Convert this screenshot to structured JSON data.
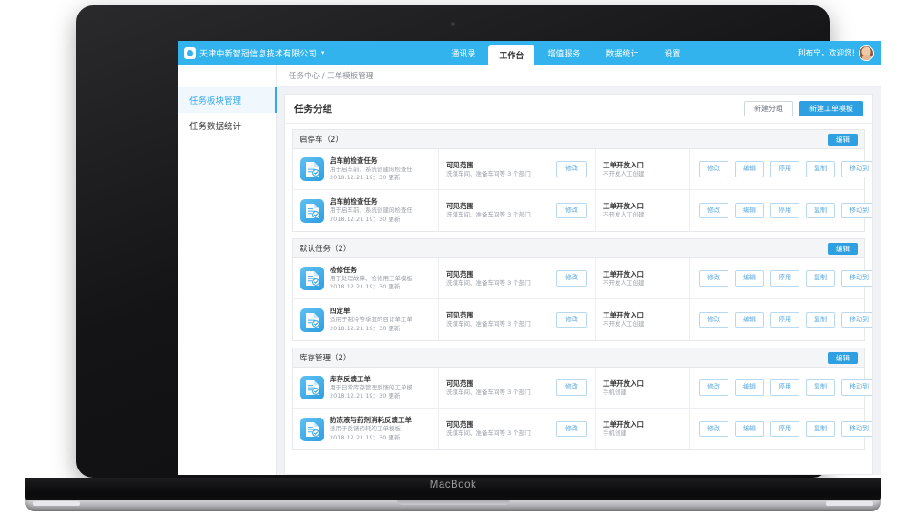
{
  "device": {
    "label": "MacBook"
  },
  "header": {
    "brand": "天津中新智冠信息技术有限公司",
    "brand_caret": "▾",
    "nav": [
      {
        "label": "通讯录",
        "active": false
      },
      {
        "label": "工作台",
        "active": true
      },
      {
        "label": "增值服务",
        "active": false
      },
      {
        "label": "数据统计",
        "active": false
      },
      {
        "label": "设置",
        "active": false
      }
    ],
    "welcome": "利布宁，欢迎您!"
  },
  "sidebar": {
    "items": [
      {
        "label": "任务板块管理",
        "active": true
      },
      {
        "label": "任务数据统计",
        "active": false
      }
    ]
  },
  "breadcrumb": "任务中心 / 工单模板管理",
  "panel": {
    "title": "任务分组",
    "new_group_label": "新建分组",
    "new_template_label": "新建工单模板",
    "group_edit_label": "编辑"
  },
  "labels": {
    "scope_label": "可见范围",
    "entry_label": "工单开放入口",
    "modify_label": "修改"
  },
  "ops": [
    "修改",
    "编辑",
    "停用",
    "复制",
    "移动到"
  ],
  "groups": [
    {
      "title": "启停车（2）",
      "rows": [
        {
          "name": "启车前检查任务",
          "desc": "用于启车前，系统创建的检查任",
          "time": "2018.12.21 19：30 更新",
          "scope": "洗煤车间、准备车间等 3 个部门",
          "entry": "不开发人工创建"
        },
        {
          "name": "启车前检查任务",
          "desc": "用于启车前，系统创建的检查任",
          "time": "2018.12.21 19：30 更新",
          "scope": "洗煤车间、准备车间等 3 个部门",
          "entry": "不开发人工创建"
        }
      ]
    },
    {
      "title": "默认任务（2）",
      "rows": [
        {
          "name": "检修任务",
          "desc": "用于处理故障、检修用工单模板",
          "time": "2018.12.21 19：30 更新",
          "scope": "洗煤车间、准备车间等 3 个部门",
          "entry": "不开发人工创建"
        },
        {
          "name": "四定单",
          "desc": "适用于制冷等季度的召订单工单",
          "time": "2018.12.21 19：30 更新",
          "scope": "洗煤车间、准备车间等 3 个部门",
          "entry": "不开发人工创建"
        }
      ]
    },
    {
      "title": "库存管理（2）",
      "rows": [
        {
          "name": "库存反馈工单",
          "desc": "用于日常库存管理反馈的工单模",
          "time": "2018.12.21 19：30 更新",
          "scope": "洗煤车间、准备车间等 3 个部门",
          "entry": "手机创建"
        },
        {
          "name": "防冻液与药剂消耗反馈工单",
          "desc": "适用于反馈药耗的工单模板",
          "time": "2018.12.21 19：30 更新",
          "scope": "洗煤车间、准备车间等 3 个部门",
          "entry": "手机创建"
        }
      ]
    }
  ],
  "colors": {
    "brand_blue": "#33b3ee",
    "primary": "#2e9fe0",
    "bg": "#f1f2f5"
  }
}
